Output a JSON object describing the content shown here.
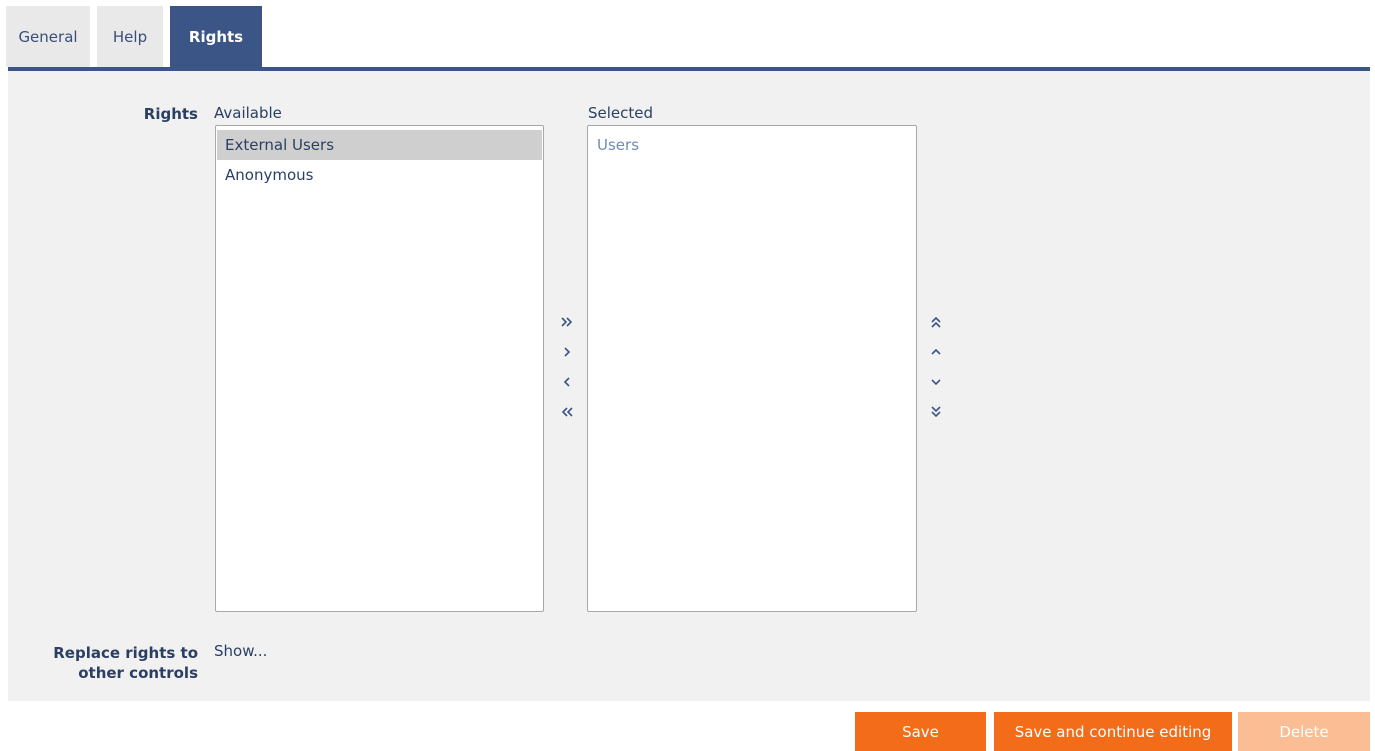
{
  "tabs": [
    {
      "label": "General",
      "active": false
    },
    {
      "label": "Help",
      "active": false
    },
    {
      "label": "Rights",
      "active": true
    }
  ],
  "form": {
    "rights_label": "Rights",
    "available_caption": "Available",
    "selected_caption": "Selected",
    "available_items": [
      "External Users",
      "Anonymous"
    ],
    "selected_items": [
      "Users"
    ],
    "replace_label_line1": "Replace rights to",
    "replace_label_line2": "other controls",
    "show_link": "Show..."
  },
  "transfer_buttons": [
    "move-all-right-icon",
    "move-right-icon",
    "move-left-icon",
    "move-all-left-icon"
  ],
  "order_buttons": [
    "move-top-icon",
    "move-up-icon",
    "move-down-icon",
    "move-bottom-icon"
  ],
  "actions": {
    "save": "Save",
    "save_continue": "Save and continue editing",
    "delete": "Delete"
  },
  "colors": {
    "accent": "#3b5686",
    "primary_button": "#f36c1a",
    "disabled_button": "#fbbd93",
    "panel": "#f1f1f1"
  }
}
